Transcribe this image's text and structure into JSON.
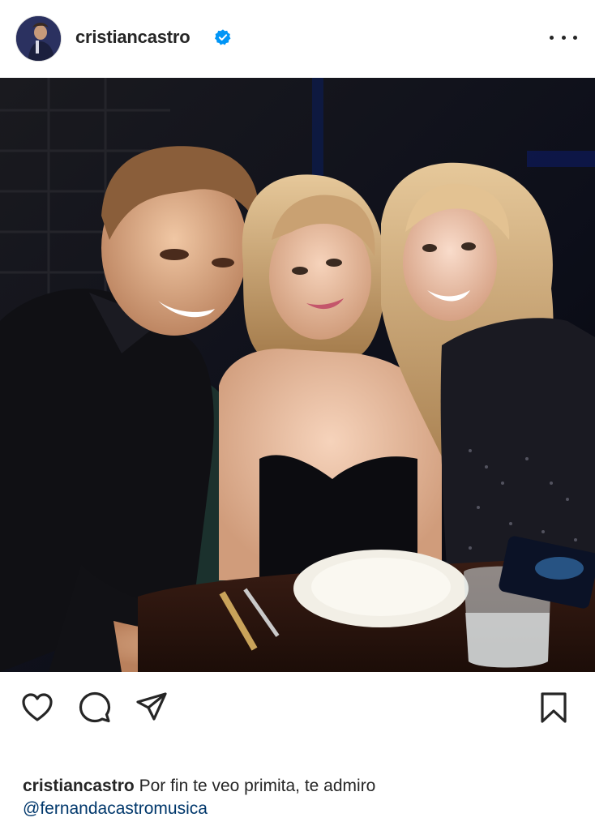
{
  "header": {
    "username": "cristiancastro",
    "verified": true,
    "icons": {
      "avatar": "profile-avatar",
      "verified": "verified-badge-icon",
      "more": "more-options-icon"
    }
  },
  "post": {
    "photo_description_icon": "post-photo"
  },
  "actions": {
    "icons": [
      "heart-icon",
      "comment-icon",
      "share-icon",
      "bookmark-icon"
    ]
  },
  "caption": {
    "username": "cristiancastro",
    "text": "Por fin te veo primita, te admiro",
    "mention": "@fernandacastromusica"
  },
  "colors": {
    "text": "#262626",
    "verified": "#0095f6",
    "mention": "#00376b",
    "background": "#ffffff"
  }
}
